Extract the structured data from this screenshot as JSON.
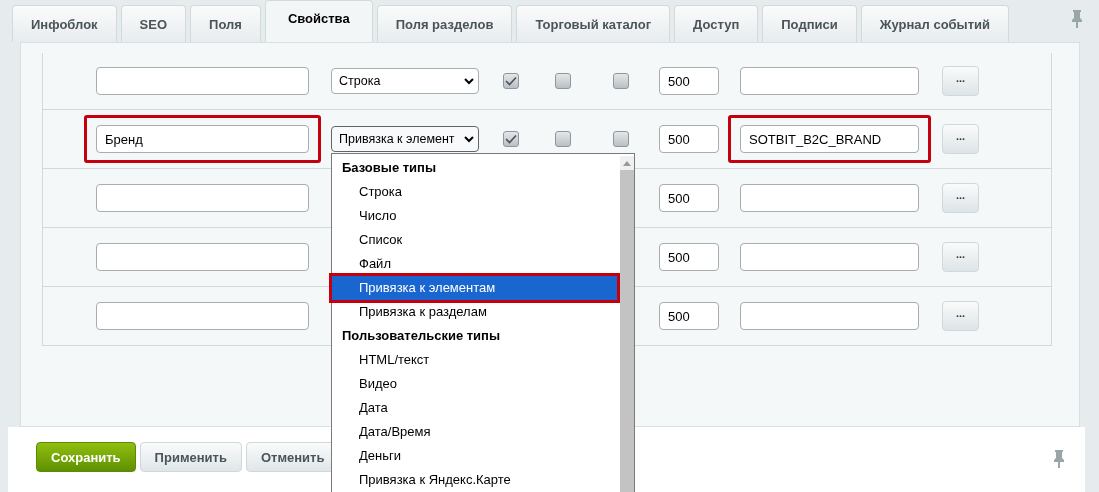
{
  "tabs": [
    {
      "label": "Инфоблок",
      "selected": false
    },
    {
      "label": "SEO",
      "selected": false
    },
    {
      "label": "Поля",
      "selected": false
    },
    {
      "label": "Свойства",
      "selected": true
    },
    {
      "label": "Поля разделов",
      "selected": false
    },
    {
      "label": "Торговый каталог",
      "selected": false
    },
    {
      "label": "Доступ",
      "selected": false
    },
    {
      "label": "Подписи",
      "selected": false
    },
    {
      "label": "Журнал событий",
      "selected": false
    }
  ],
  "rows": [
    {
      "type": "Строка",
      "flags": [
        true,
        false,
        false
      ],
      "sort": "500",
      "more": "...",
      "highlighted": false
    },
    {
      "name": "Бренд",
      "type": "Привязка к элемент",
      "flags": [
        true,
        false,
        false
      ],
      "sort": "500",
      "code": "SOTBIT_B2C_BRAND",
      "more": "...",
      "highlighted": true,
      "open": true
    },
    {
      "sort": "500",
      "more": "...",
      "highlighted": false
    },
    {
      "sort": "500",
      "more": "...",
      "highlighted": false
    },
    {
      "sort": "500",
      "more": "...",
      "highlighted": false
    }
  ],
  "type_dropdown": {
    "groups": [
      {
        "label": "Базовые типы",
        "options": [
          {
            "label": "Строка",
            "selected": false
          },
          {
            "label": "Число",
            "selected": false
          },
          {
            "label": "Список",
            "selected": false
          },
          {
            "label": "Файл",
            "selected": false
          },
          {
            "label": "Привязка к элементам",
            "selected": true
          },
          {
            "label": "Привязка к разделам",
            "selected": false
          }
        ]
      },
      {
        "label": "Пользовательские типы",
        "options": [
          {
            "label": "HTML/текст",
            "selected": false
          },
          {
            "label": "Видео",
            "selected": false
          },
          {
            "label": "Дата",
            "selected": false
          },
          {
            "label": "Дата/Время",
            "selected": false
          },
          {
            "label": "Деньги",
            "selected": false
          },
          {
            "label": "Привязка к Яндекс.Карте",
            "selected": false
          }
        ]
      }
    ]
  },
  "buttons": [
    {
      "label": "Сохранить",
      "kind": "primary"
    },
    {
      "label": "Применить",
      "kind": "secondary"
    },
    {
      "label": "Отменить",
      "kind": "secondary"
    }
  ]
}
